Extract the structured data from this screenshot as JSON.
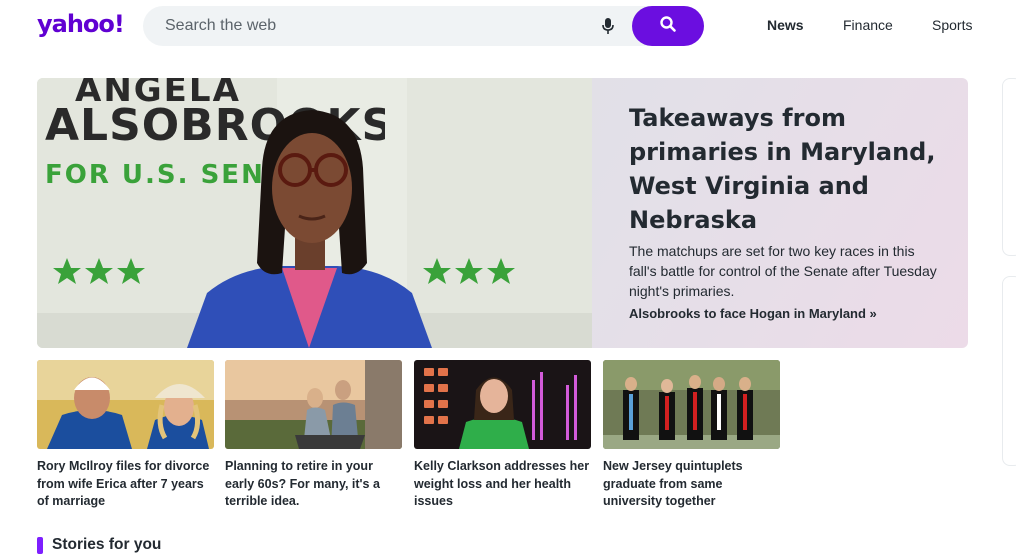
{
  "header": {
    "logo": "yahoo!",
    "search_placeholder": "Search the web",
    "nav": [
      {
        "label": "News",
        "active": true
      },
      {
        "label": "Finance",
        "active": false
      },
      {
        "label": "Sports",
        "active": false
      }
    ]
  },
  "hero": {
    "title": "Takeaways from primaries in Maryland, West Virginia and Nebraska",
    "description": "The matchups are set for two key races in this fall's battle for control of the Senate after Tuesday night's primaries.",
    "link": "Alsobrooks to face Hogan in Maryland »",
    "banner_text_1": "ANGELA",
    "banner_text_2": "ALSOBROOKS",
    "banner_text_3": "FOR U.S. SENATE"
  },
  "cards": [
    {
      "caption": "Rory McIlroy files for divorce from wife Erica after 7 years of marriage"
    },
    {
      "caption": "Planning to retire in your early 60s? For many, it's a terrible idea."
    },
    {
      "caption": "Kelly Clarkson addresses her weight loss and her health issues"
    },
    {
      "caption": "New Jersey quintuplets graduate from same university together"
    }
  ],
  "section": {
    "label": "Stories for you"
  },
  "colors": {
    "brand": "#6001d2",
    "accent": "#7e1fff"
  }
}
